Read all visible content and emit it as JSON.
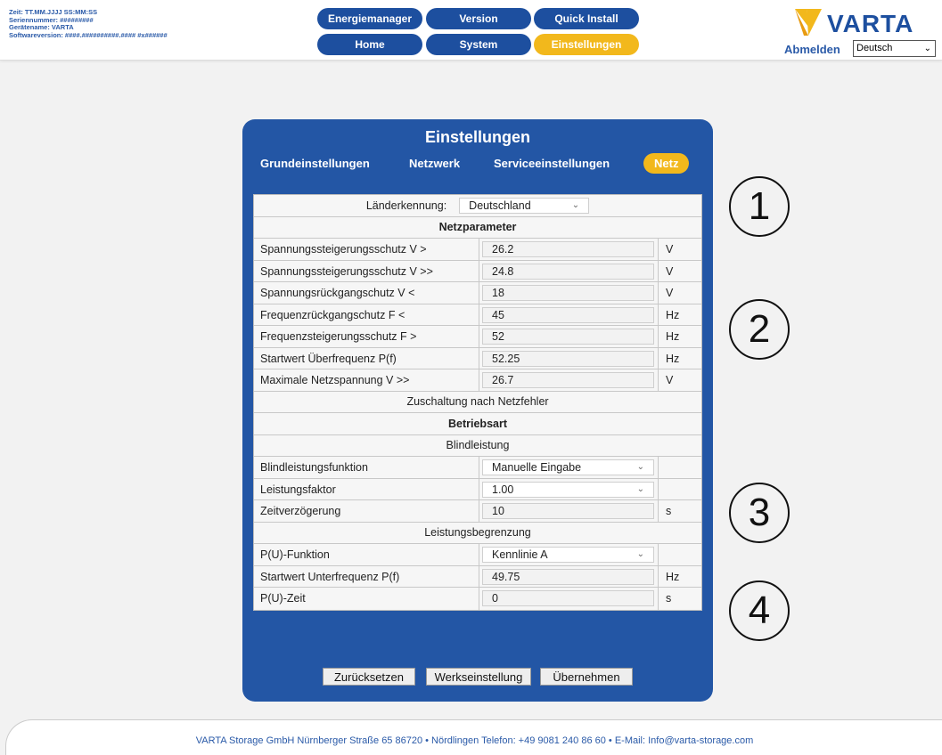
{
  "header": {
    "info_lines": [
      "Zeit: TT.MM.JJJJ SS:MM:SS",
      "Seriennummer: #########",
      "Gerätename: VARTA",
      "Softwareversion: ####.##########.#### #x######"
    ],
    "nav": [
      {
        "label": "Energiemanager",
        "active": false
      },
      {
        "label": "Version",
        "active": false
      },
      {
        "label": "Quick Install",
        "active": false
      },
      {
        "label": "Home",
        "active": false
      },
      {
        "label": "System",
        "active": false
      },
      {
        "label": "Einstellungen",
        "active": true
      }
    ],
    "logo_text": "VARTA",
    "logout_label": "Abmelden",
    "language_selected": "Deutsch"
  },
  "panel": {
    "title": "Einstellungen",
    "tabs": [
      {
        "label": "Grundeinstellungen",
        "active": false
      },
      {
        "label": "Netzwerk",
        "active": false
      },
      {
        "label": "Serviceeinstellungen",
        "active": false
      },
      {
        "label": "Netz",
        "active": true
      }
    ],
    "country_label": "Länderkennung:",
    "country_value": "Deutschland",
    "netzparameter_heading": "Netzparameter",
    "params": [
      {
        "label": "Spannungssteigerungsschutz V >",
        "value": "26.2",
        "unit": "V"
      },
      {
        "label": "Spannungssteigerungsschutz V >>",
        "value": "24.8",
        "unit": "V"
      },
      {
        "label": "Spannungsrückgangschutz V <",
        "value": "18",
        "unit": "V"
      },
      {
        "label": "Frequenzrückgangschutz F <",
        "value": "45",
        "unit": "Hz"
      },
      {
        "label": "Frequenzsteigerungsschutz F >",
        "value": "52",
        "unit": "Hz"
      },
      {
        "label": "Startwert Überfrequenz P(f)",
        "value": "52.25",
        "unit": "Hz"
      },
      {
        "label": "Maximale Netzspannung V >>",
        "value": "26.7",
        "unit": "V"
      }
    ],
    "zuschaltung": "Zuschaltung nach Netzfehler",
    "betriebsart_heading": "Betriebsart",
    "blindleistung_heading": "Blindleistung",
    "blind_function_label": "Blindleistungsfunktion",
    "blind_function_value": "Manuelle Eingabe",
    "power_factor_label": "Leistungsfaktor",
    "power_factor_value": "1.00",
    "delay_label": "Zeitverzögerung",
    "delay_value": "10",
    "delay_unit": "s",
    "leistungsbegrenzung_heading": "Leistungsbegrenzung",
    "pu_function_label": "P(U)-Funktion",
    "pu_function_value": "Kennlinie A",
    "underfreq_label": "Startwert Unterfrequenz P(f)",
    "underfreq_value": "49.75",
    "underfreq_unit": "Hz",
    "pu_time_label": "P(U)-Zeit",
    "pu_time_value": "0",
    "pu_time_unit": "s",
    "buttons": {
      "reset": "Zurücksetzen",
      "factory": "Werkseinstellung",
      "apply": "Übernehmen"
    }
  },
  "callouts": [
    "1",
    "2",
    "3",
    "4"
  ],
  "footer": "VARTA Storage GmbH Nürnberger Straße 65 86720 • Nördlingen Telefon: +49 9081 240 86 60 • E-Mail: Info@varta-storage.com",
  "colors": {
    "primary": "#2356a5",
    "accent": "#f2b81c",
    "link": "#2a5aa8"
  }
}
